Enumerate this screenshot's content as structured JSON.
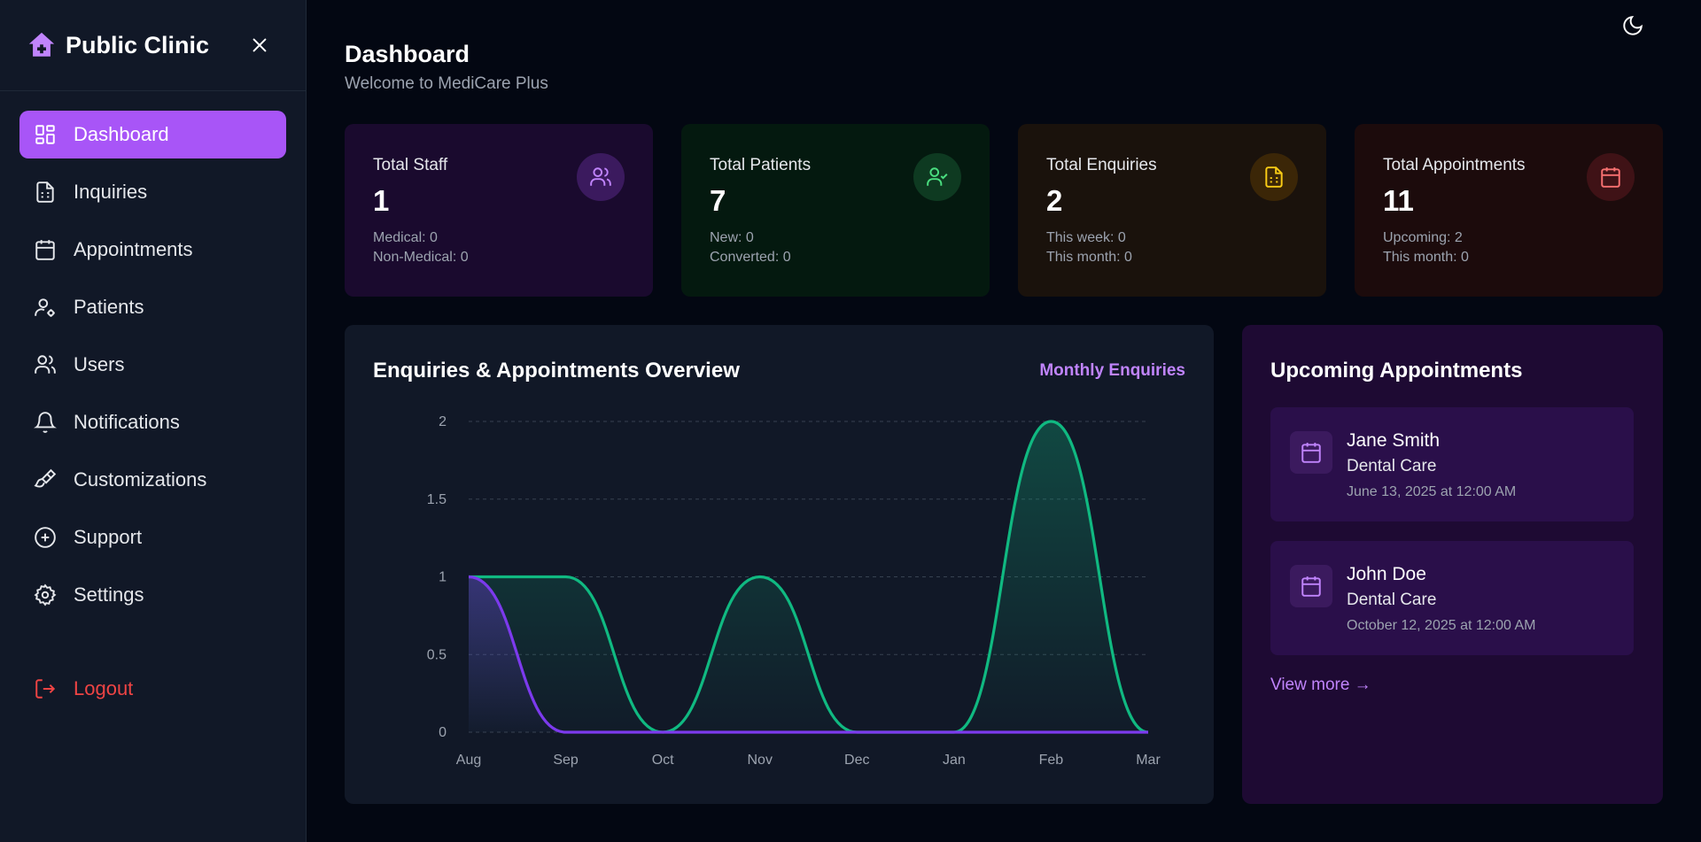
{
  "brand": {
    "title": "Public Clinic"
  },
  "sidebar": {
    "items": [
      {
        "label": "Dashboard",
        "icon": "dashboard-icon",
        "active": true
      },
      {
        "label": "Inquiries",
        "icon": "document-icon"
      },
      {
        "label": "Appointments",
        "icon": "calendar-icon"
      },
      {
        "label": "Patients",
        "icon": "user-gear-icon"
      },
      {
        "label": "Users",
        "icon": "users-icon"
      },
      {
        "label": "Notifications",
        "icon": "bell-icon"
      },
      {
        "label": "Customizations",
        "icon": "brush-icon"
      },
      {
        "label": "Support",
        "icon": "plus-circle-icon"
      },
      {
        "label": "Settings",
        "icon": "gear-icon"
      }
    ],
    "logout": "Logout"
  },
  "header": {
    "title": "Dashboard",
    "subtitle": "Welcome to MediCare Plus"
  },
  "stats": [
    {
      "label": "Total Staff",
      "value": "1",
      "sub1": "Medical: 0",
      "sub2": "Non-Medical: 0",
      "color": "#c084fc"
    },
    {
      "label": "Total Patients",
      "value": "7",
      "sub1": "New: 0",
      "sub2": "Converted: 0",
      "color": "#4ade80"
    },
    {
      "label": "Total Enquiries",
      "value": "2",
      "sub1": "This week: 0",
      "sub2": "This month: 0",
      "color": "#facc15"
    },
    {
      "label": "Total Appointments",
      "value": "11",
      "sub1": "Upcoming: 2",
      "sub2": "This month: 0",
      "color": "#f87171"
    }
  ],
  "chart": {
    "title": "Enquiries & Appointments Overview",
    "toggle_label": "Monthly Enquiries"
  },
  "chart_data": {
    "type": "area",
    "categories": [
      "Aug",
      "Sep",
      "Oct",
      "Nov",
      "Dec",
      "Jan",
      "Feb",
      "Mar"
    ],
    "yticks": [
      "0",
      "0.5",
      "1",
      "1.5",
      "2"
    ],
    "ylim": [
      0,
      2
    ],
    "series": [
      {
        "values": [
          1,
          1,
          0,
          1,
          0,
          0,
          2,
          0
        ],
        "color": "#10b981"
      },
      {
        "values": [
          1,
          0,
          0,
          0,
          0,
          0,
          0,
          0
        ],
        "color": "#7c3aed"
      }
    ],
    "grid": true
  },
  "appointments": {
    "title": "Upcoming Appointments",
    "items": [
      {
        "name": "Jane Smith",
        "service": "Dental Care",
        "date": "June 13, 2025 at 12:00 AM"
      },
      {
        "name": "John Doe",
        "service": "Dental Care",
        "date": "October 12, 2025 at 12:00 AM"
      }
    ],
    "view_more": "View more →"
  }
}
